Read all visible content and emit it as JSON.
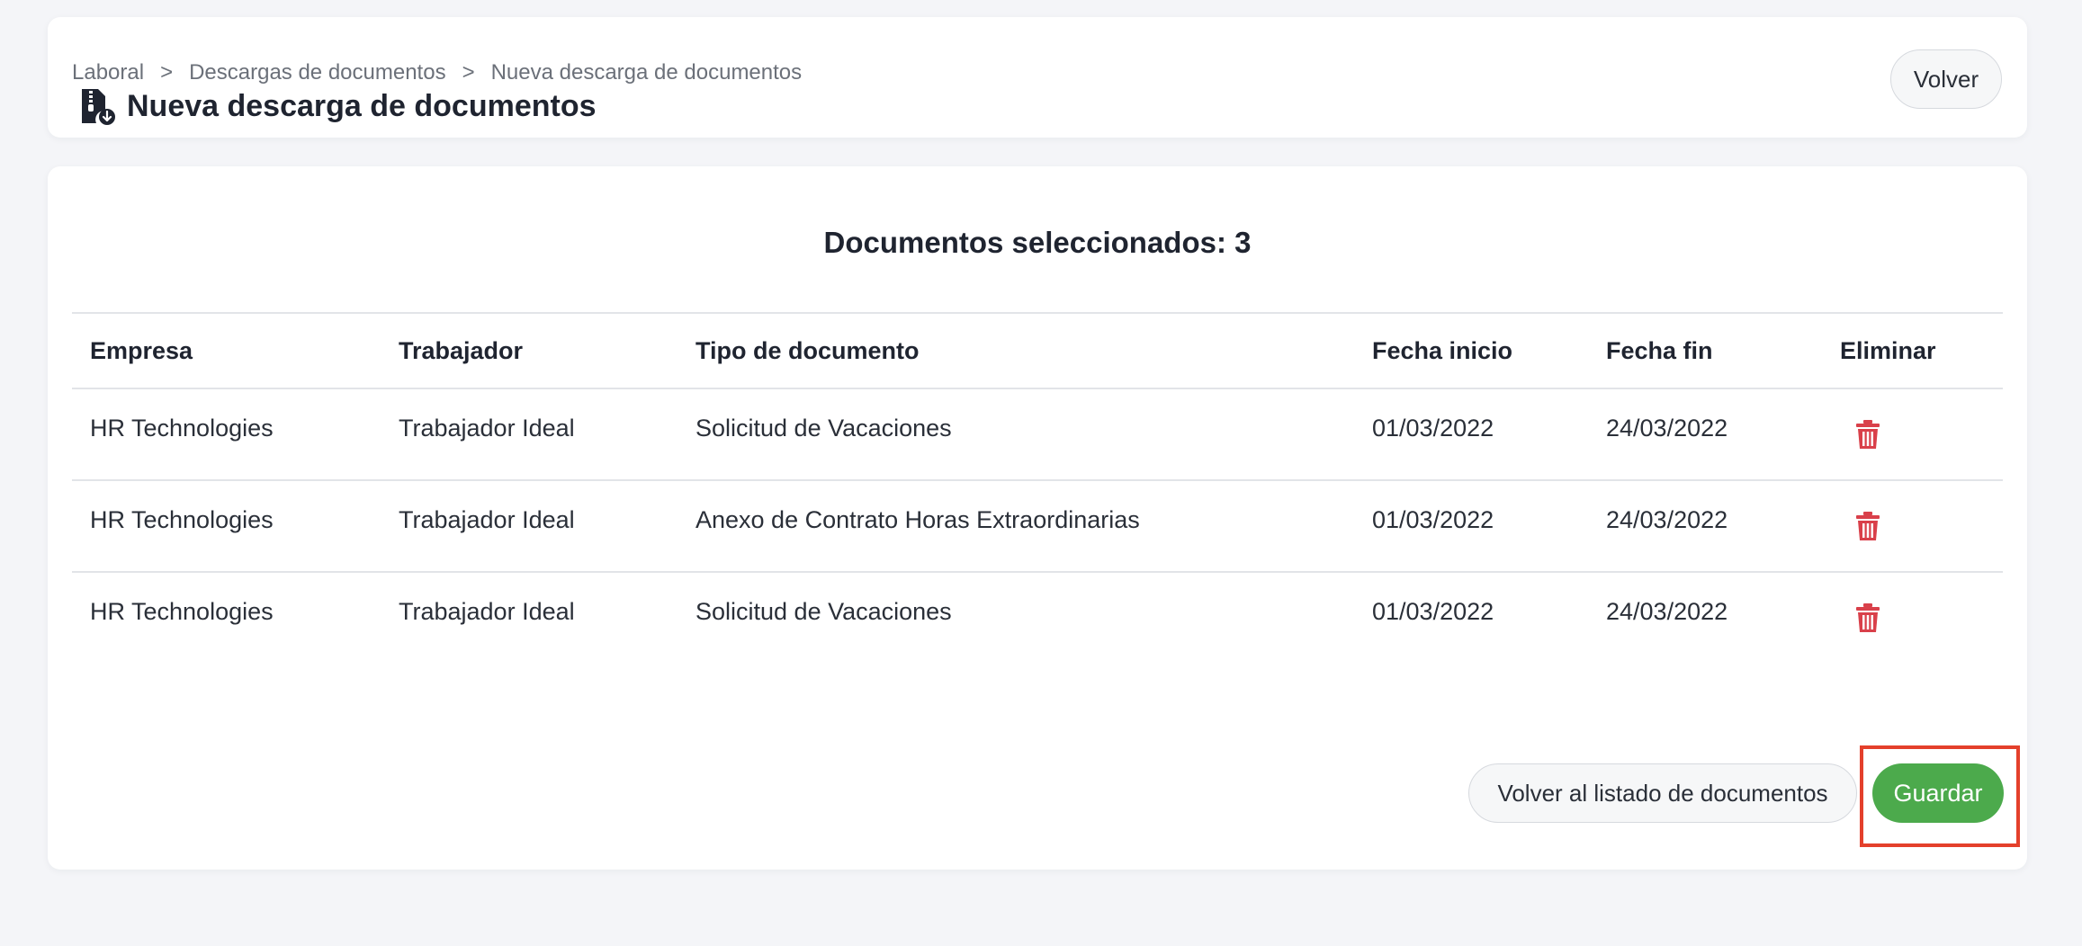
{
  "breadcrumb": [
    "Laboral",
    "Descargas de documentos",
    "Nueva descarga de documentos"
  ],
  "breadcrumb_separator": ">",
  "header": {
    "title": "Nueva descarga de documentos",
    "title_icon": "file-zip-download-icon",
    "back_label": "Volver"
  },
  "main": {
    "section_title": "Documentos seleccionados: 3",
    "columns": [
      "Empresa",
      "Trabajador",
      "Tipo de documento",
      "Fecha inicio",
      "Fecha fin",
      "Eliminar"
    ],
    "rows": [
      {
        "empresa": "HR Technologies",
        "trabajador": "Trabajador Ideal",
        "tipo": "Solicitud de Vacaciones",
        "inicio": "01/03/2022",
        "fin": "24/03/2022"
      },
      {
        "empresa": "HR Technologies",
        "trabajador": "Trabajador Ideal",
        "tipo": "Anexo de Contrato Horas Extraordinarias",
        "inicio": "01/03/2022",
        "fin": "24/03/2022"
      },
      {
        "empresa": "HR Technologies",
        "trabajador": "Trabajador Ideal",
        "tipo": "Solicitud de Vacaciones",
        "inicio": "01/03/2022",
        "fin": "24/03/2022"
      }
    ],
    "delete_icon": "trash-icon",
    "back_to_list_label": "Volver al listado de documentos",
    "save_label": "Guardar"
  },
  "colors": {
    "save_green": "#4caa4c",
    "delete_red": "#d9404a",
    "highlight_red": "#e4402b",
    "background": "#f4f5f8"
  }
}
